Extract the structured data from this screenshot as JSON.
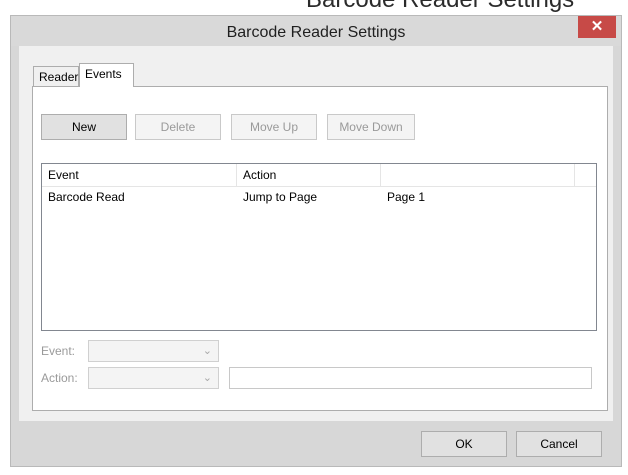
{
  "background": {
    "cut_title": "Barcode Reader Settings"
  },
  "window": {
    "title": "Barcode Reader Settings",
    "close_glyph": "✕"
  },
  "tabs": [
    {
      "label": "Reader",
      "active": false
    },
    {
      "label": "Events",
      "active": true
    }
  ],
  "toolbar": {
    "new_label": "New",
    "delete_label": "Delete",
    "move_up_label": "Move Up",
    "move_down_label": "Move Down"
  },
  "events_table": {
    "columns": [
      "Event",
      "Action",
      ""
    ],
    "rows": [
      {
        "event": "Barcode Read",
        "action": "Jump to Page",
        "target": "Page 1"
      }
    ]
  },
  "form": {
    "event_label": "Event:",
    "event_value": "",
    "action_label": "Action:",
    "action_value": "",
    "action_param": ""
  },
  "footer": {
    "ok_label": "OK",
    "cancel_label": "Cancel"
  },
  "icons": {
    "chevron": "chevron-down-icon",
    "close": "close-icon"
  },
  "colors": {
    "close_button": "#c74a47",
    "window_frame": "#d7d7d7",
    "client": "#f0f0f0"
  }
}
